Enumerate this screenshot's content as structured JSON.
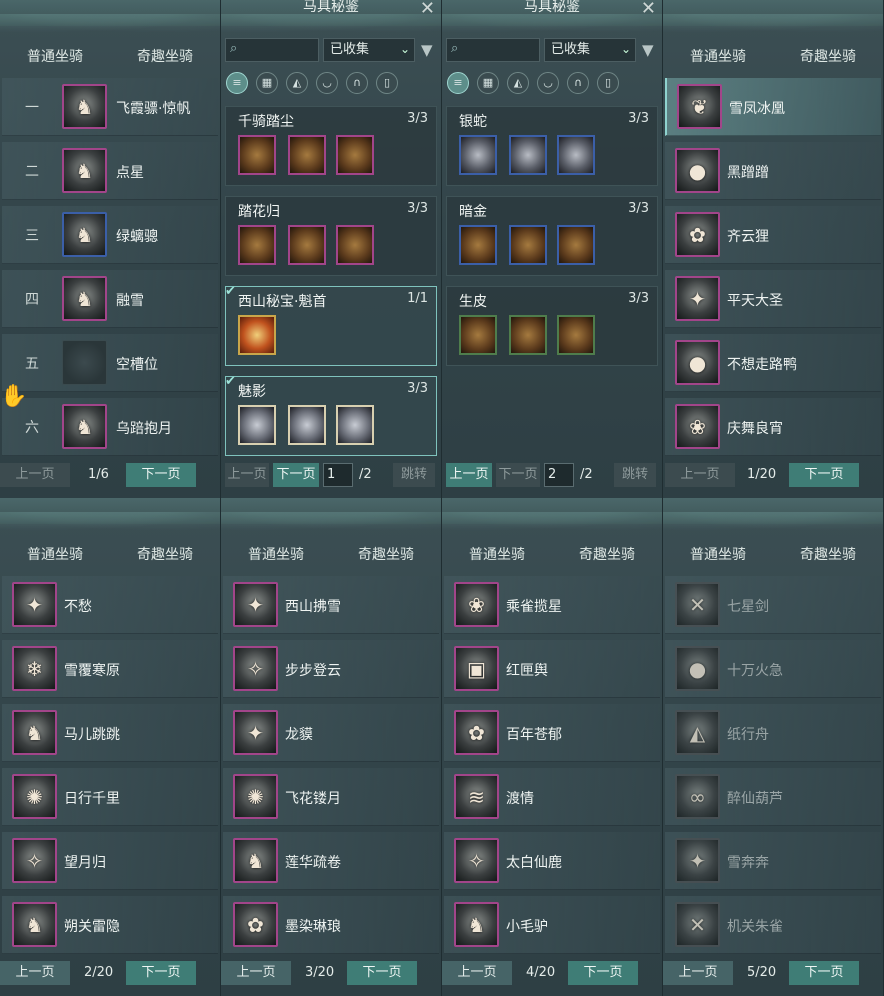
{
  "tabs": {
    "normal": "普通坐骑",
    "fun": "奇趣坐骑"
  },
  "pager": {
    "prev": "上一页",
    "next": "下一页"
  },
  "p1": {
    "page": "1/6",
    "rows": [
      {
        "num": "一",
        "name": "飞霞骠·惊帆",
        "glyph": "♞"
      },
      {
        "num": "二",
        "name": "点星",
        "glyph": "♞"
      },
      {
        "num": "三",
        "name": "绿螭骢",
        "glyph": "♞"
      },
      {
        "num": "四",
        "name": "融雪",
        "glyph": "♞"
      },
      {
        "num": "五",
        "name": "空槽位",
        "glyph": ""
      },
      {
        "num": "六",
        "name": "乌踣抱月",
        "glyph": "♞"
      }
    ]
  },
  "c1": {
    "title": "马具秘鉴",
    "filter": "已收集",
    "sets": [
      {
        "name": "千骑踏尘",
        "count": "3/3"
      },
      {
        "name": "踏花归",
        "count": "3/3"
      },
      {
        "name": "西山秘宝·魁首",
        "count": "1/1"
      },
      {
        "name": "魅影",
        "count": "3/3"
      }
    ],
    "jump": {
      "prev": "上一页",
      "next": "下一页",
      "input": "1",
      "total": "/2",
      "go": "跳转"
    }
  },
  "c2": {
    "title": "马具秘鉴",
    "filter": "已收集",
    "sets": [
      {
        "name": "银蛇",
        "count": "3/3"
      },
      {
        "name": "暗金",
        "count": "3/3"
      },
      {
        "name": "生皮",
        "count": "3/3"
      }
    ],
    "jump": {
      "prev": "上一页",
      "next": "下一页",
      "input": "2",
      "total": "/2",
      "go": "跳转"
    }
  },
  "p4": {
    "page": "1/20",
    "rows": [
      {
        "name": "雪凤冰凰",
        "glyph": "❦"
      },
      {
        "name": "黑蹭蹭",
        "glyph": "●"
      },
      {
        "name": "齐云狸",
        "glyph": "✿"
      },
      {
        "name": "平天大圣",
        "glyph": "✦"
      },
      {
        "name": "不想走路鸭",
        "glyph": "●"
      },
      {
        "name": "庆舞良宵",
        "glyph": "❀"
      }
    ]
  },
  "p5": {
    "page": "2/20",
    "rows": [
      {
        "name": "不愁",
        "glyph": "✦"
      },
      {
        "name": "雪覆寒原",
        "glyph": "❄"
      },
      {
        "name": "马儿跳跳",
        "glyph": "♞"
      },
      {
        "name": "日行千里",
        "glyph": "✺"
      },
      {
        "name": "望月归",
        "glyph": "✧"
      },
      {
        "name": "朔关雷隐",
        "glyph": "♞"
      }
    ]
  },
  "p6": {
    "page": "3/20",
    "rows": [
      {
        "name": "西山拂雪",
        "glyph": "✦"
      },
      {
        "name": "步步登云",
        "glyph": "✧"
      },
      {
        "name": "龙貘",
        "glyph": "✦"
      },
      {
        "name": "飞花镂月",
        "glyph": "✺"
      },
      {
        "name": "莲华疏卷",
        "glyph": "♞"
      },
      {
        "name": "墨染琳琅",
        "glyph": "✿"
      }
    ]
  },
  "p7": {
    "page": "4/20",
    "rows": [
      {
        "name": "乘雀揽星",
        "glyph": "❀"
      },
      {
        "name": "红匣舆",
        "glyph": "▣"
      },
      {
        "name": "百年苍郁",
        "glyph": "✿"
      },
      {
        "name": "渡情",
        "glyph": "≋"
      },
      {
        "name": "太白仙鹿",
        "glyph": "✧"
      },
      {
        "name": "小毛驴",
        "glyph": "♞"
      }
    ]
  },
  "p8": {
    "page": "5/20",
    "rows": [
      {
        "name": "七星剑",
        "glyph": "✕"
      },
      {
        "name": "十万火急",
        "glyph": "●"
      },
      {
        "name": "纸行舟",
        "glyph": "◭"
      },
      {
        "name": "醉仙葫芦",
        "glyph": "∞"
      },
      {
        "name": "雪奔奔",
        "glyph": "✦"
      },
      {
        "name": "机关朱雀",
        "glyph": "✕"
      }
    ]
  }
}
